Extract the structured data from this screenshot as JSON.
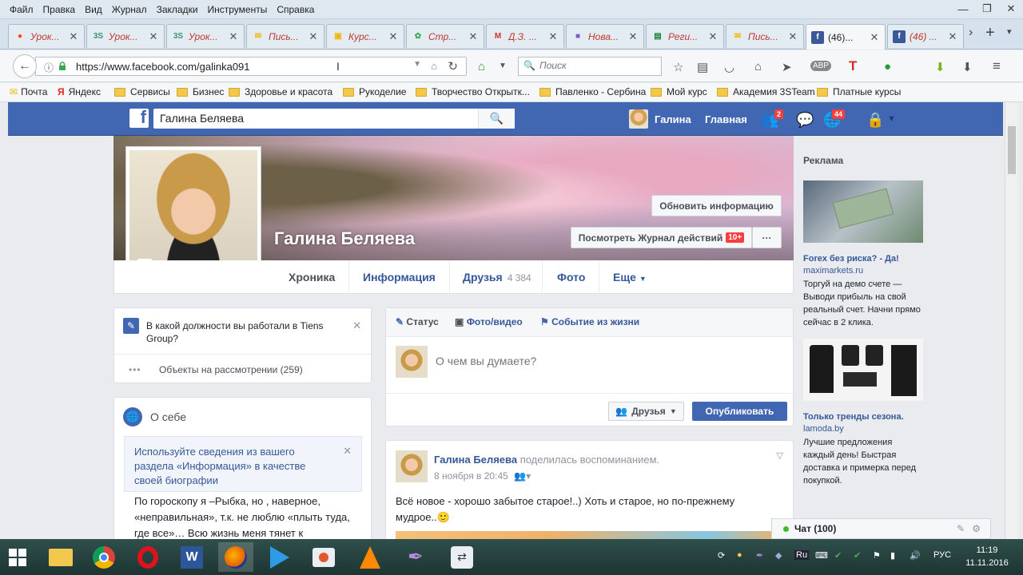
{
  "menu": [
    "Файл",
    "Правка",
    "Вид",
    "Журнал",
    "Закладки",
    "Инструменты",
    "Справка"
  ],
  "window_controls": [
    "—",
    "❐",
    "✕"
  ],
  "tabs": [
    {
      "label": "Урок...",
      "icon": "",
      "icon_color": "#ff4500"
    },
    {
      "label": "Урок...",
      "icon": "3S",
      "icon_color": "#3d8f7a"
    },
    {
      "label": "Урок...",
      "icon": "3S",
      "icon_color": "#3d8f7a"
    },
    {
      "label": "Пись...",
      "icon": "",
      "icon_color": "#f2b600"
    },
    {
      "label": "Курс...",
      "icon": "",
      "icon_color": "#f5b400"
    },
    {
      "label": "Стр...",
      "icon": "",
      "icon_color": "#3aa757"
    },
    {
      "label": "Д.З. ...",
      "icon": "M",
      "icon_color": "#d93025"
    },
    {
      "label": "Нова...",
      "icon": "",
      "icon_color": "#7b5fc7"
    },
    {
      "label": "Реги...",
      "icon": "",
      "icon_color": "#188038"
    },
    {
      "label": "Пись...",
      "icon": "",
      "icon_color": "#f2b600"
    },
    {
      "label": "(46)...",
      "icon": "f",
      "icon_color": "#3b5998"
    },
    {
      "label": "(46) ...",
      "icon": "f",
      "icon_color": "#3b5998"
    }
  ],
  "address": {
    "url": "https://www.facebook.com/galinka091"
  },
  "search": {
    "placeholder": "Поиск"
  },
  "bookmarks": [
    "Почта",
    "Яндекс",
    "Сервисы",
    "Бизнес",
    "Здоровье и красота",
    "Рукоделие",
    "Творчество Открытк...",
    "Павленко - Сербина",
    "Мой курс",
    "Академия 3STeam",
    "Платные курсы"
  ],
  "fb": {
    "search_value": "Галина Беляева",
    "user_name": "Галина",
    "home_label": "Главная",
    "friend_requests": "2",
    "notifications": "44"
  },
  "profile": {
    "name": "Галина Беляева",
    "update_btn": "Обновить информацию",
    "activity_btn": "Посмотреть Журнал действий",
    "activity_badge": "10+",
    "more_dots": "···"
  },
  "timeline_nav": {
    "chronicle": "Хроника",
    "info": "Информация",
    "friends": "Друзья",
    "friends_count": "4 384",
    "photos": "Фото",
    "more": "Еще"
  },
  "question_card": {
    "question": "В какой должности вы работали в Tiens Group?",
    "pending": "Объекты на рассмотрении (259)"
  },
  "about": {
    "title": "О себе",
    "tip": "Используйте сведения из вашего раздела «Информация» в качестве своей биографии",
    "bio": "По гороскопу я –Рыбка, но , наверное, «неправильная», т.к. не люблю «плыть туда, где все»… Всю жизнь меня тянет к"
  },
  "composer": {
    "status": "Статус",
    "photo_video": "Фото/видео",
    "life_event": "Событие из жизни",
    "placeholder": "О чем вы думаете?",
    "audience": "Друзья",
    "publish": "Опубликовать"
  },
  "post": {
    "author": "Галина Беляева",
    "action": "поделилась воспоминанием.",
    "date": "8 ноября в 20:45",
    "text": "Всё новое - хорошо забытое старое!..) Хоть и старое, но по-прежнему мудрое..🙂"
  },
  "ads": {
    "heading": "Реклама",
    "items": [
      {
        "title": "Forex без риска? - Да!",
        "domain": "maximarkets.ru",
        "text": "Торгуй на демо счете — Выводи прибыль на свой реальный счет. Начни прямо сейчас в 2 клика."
      },
      {
        "title": "Только тренды сезона.",
        "domain": "lamoda.by",
        "text": "Лучшие предложения каждый день! Быстрая доставка и примерка перед покупкой."
      }
    ]
  },
  "chat": {
    "label": "Чат (100)"
  },
  "taskbar": {
    "lang": "РУС",
    "time": "11:19",
    "date": "11.11.2016"
  }
}
